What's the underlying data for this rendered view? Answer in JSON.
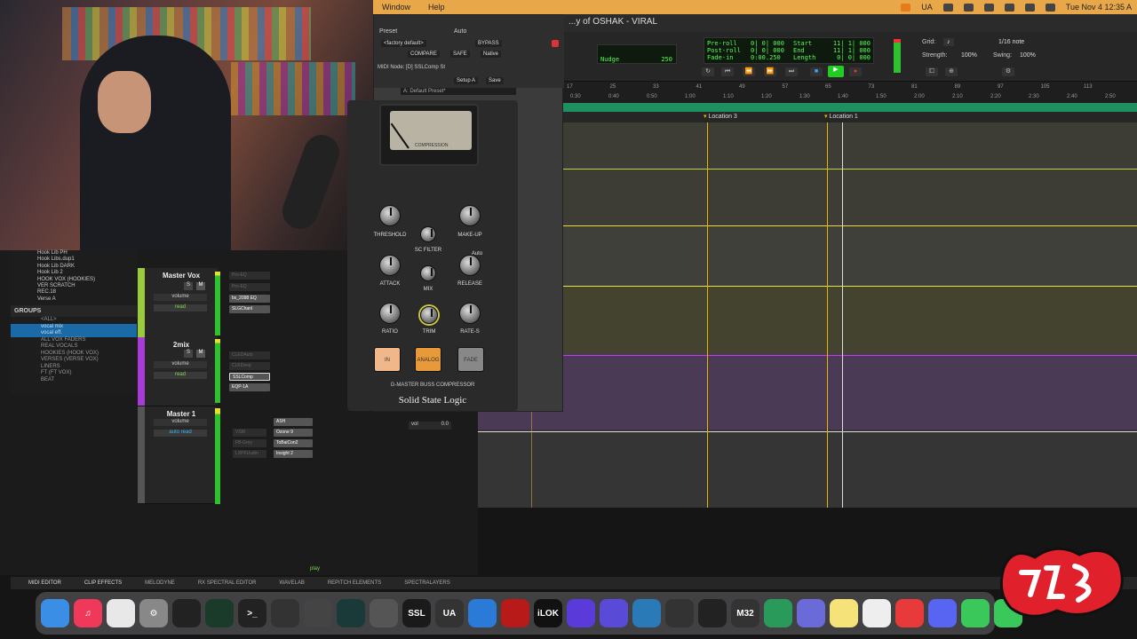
{
  "menubar": {
    "items": [
      "Window",
      "Help"
    ],
    "right": {
      "lang": "UA",
      "datetime": "Tue Nov 4  12:35 A"
    }
  },
  "session": {
    "title": "...y of OSHAK - VIRAL"
  },
  "transport": {
    "grid_label": "Grid:",
    "grid_value": "1/16 note",
    "strength_label": "Strength:",
    "strength_value": "100%",
    "swing_label": "Swing:",
    "swing_value": "100%",
    "nudge_label": "Nudge",
    "nudge_value": "250",
    "preroll": "Pre-roll",
    "postroll": "Post-roll",
    "fadein": "Fade-in",
    "start": "Start",
    "end": "End",
    "length": "Length",
    "preroll_val": "0| 0| 000",
    "postroll_val": "0| 0| 000",
    "fadein_val": "0:00.250",
    "start_val": "11| 1| 000",
    "end_val": "11| 1| 000",
    "length_val": "0| 0| 000"
  },
  "ruler": {
    "bars": [
      "17",
      "25",
      "33",
      "41",
      "49",
      "57",
      "65",
      "73",
      "81",
      "89",
      "97",
      "105",
      "113"
    ],
    "times": [
      "0:30",
      "0:40",
      "0:50",
      "1:00",
      "1:10",
      "1:20",
      "1:30",
      "1:40",
      "1:50",
      "2:00",
      "2:10",
      "2:20",
      "2:30",
      "2:40",
      "2:50"
    ]
  },
  "markers": [
    {
      "label": "Location 3"
    },
    {
      "label": "Location 1"
    }
  ],
  "plugin": {
    "preset_label": "Preset",
    "auto_label": "Auto",
    "preset_value": "<factory default>",
    "compare": "COMPARE",
    "bypass": "BYPASS",
    "safe": "SAFE",
    "native": "Native",
    "midi_node": "MIDI Node: [D] SSLComp St",
    "setup": "Setup A",
    "save": "Save",
    "preset_name": "A: Default Preset*",
    "meter_label": "COMPRESSION",
    "knobs": {
      "threshold": "THRESHOLD",
      "makeup": "MAKE-UP",
      "scfilter": "SC FILTER",
      "attack": "ATTACK",
      "release": "RELEASE",
      "mix": "MIX",
      "ratio": "RATIO",
      "trim": "TRIM",
      "rates": "RATE-S",
      "auto": "Auto"
    },
    "buttons": {
      "in": "IN",
      "analog": "ANALOG",
      "fade": "FADE OFF"
    },
    "product": "G-MASTER BUSS COMPRESSOR",
    "brand": "Solid State Logic"
  },
  "tracklist": [
    "Hook Lib PH",
    "Hook Libs.dup1",
    "Hook Lib DARK",
    "Hook Lib 2",
    "HOOK VOX (HOOKIES)",
    "VER SCRATCH",
    "REC.18",
    "Verse A"
  ],
  "groups": {
    "header": "GROUPS",
    "items": [
      "<ALL>",
      "vocal mix",
      "vocal eff.",
      "ALL VOX FADERS",
      "REAL VOCALS",
      "HOOKIES (HOOK VOX)",
      "VERSES (VERSE VOX)",
      "LINERS",
      "FT (FT VOX)",
      "BEAT"
    ]
  },
  "strips": [
    {
      "name": "Master Vox",
      "vol": "volume",
      "auto": "read",
      "inserts": [
        "Pro-EQ",
        "Pro-EQ",
        "bx_2098 EQ",
        "SLGChanl"
      ]
    },
    {
      "name": "2mix",
      "vol": "volume",
      "auto": "read",
      "inserts": [
        "CLEDAuto",
        "CLKDeep",
        "SSLComp",
        "EQP-1A"
      ]
    },
    {
      "name": "Master 1",
      "vol": "volume",
      "auto": "auto read",
      "inserts": [
        "ASH",
        "Ozone 9",
        "ToBaiCon2",
        "Insight 2"
      ],
      "dims": [
        "VSM",
        "FB-Grey",
        "LXPFUudm"
      ]
    }
  ],
  "mix_extra": {
    "vol_label": "vol",
    "vol_value": "0.0",
    "play_label": "play"
  },
  "bottom_tabs": [
    "MIDI EDITOR",
    "CLIP EFFECTS",
    "MELODYNE",
    "RX SPECTRAL EDITOR",
    "WAVELAB",
    "REPITCH ELEMENTS",
    "SPECTRALAYERS"
  ],
  "dock": [
    {
      "name": "finder-icon",
      "label": "",
      "color": "#3a8ee6"
    },
    {
      "name": "music-icon",
      "label": "♫",
      "color": "#f0385a"
    },
    {
      "name": "chrome-icon",
      "label": "",
      "color": "#e8e8e8"
    },
    {
      "name": "settings-icon",
      "label": "⚙",
      "color": "#888"
    },
    {
      "name": "piano-icon",
      "label": "",
      "color": "#222"
    },
    {
      "name": "activity-icon",
      "label": "",
      "color": "#1a3a2a"
    },
    {
      "name": "terminal-icon",
      "label": ">_",
      "color": "#222"
    },
    {
      "name": "pro-tools-icon",
      "label": "",
      "color": "#333"
    },
    {
      "name": "crop-icon",
      "label": "",
      "color": "#444"
    },
    {
      "name": "wave-icon",
      "label": "",
      "color": "#1a3a3a"
    },
    {
      "name": "clip-icon",
      "label": "",
      "color": "#555"
    },
    {
      "name": "ssl-icon",
      "label": "SSL",
      "color": "#1a1a1a"
    },
    {
      "name": "ua-icon",
      "label": "UA",
      "color": "#333"
    },
    {
      "name": "waves-icon",
      "label": "",
      "color": "#2a7ad8"
    },
    {
      "name": "red-icon",
      "label": "",
      "color": "#b81a1a"
    },
    {
      "name": "ilok-icon",
      "label": "iLOK",
      "color": "#111"
    },
    {
      "name": "native-access-icon",
      "label": "",
      "color": "#5a3ad8"
    },
    {
      "name": "avid-icon",
      "label": "",
      "color": "#5a4ad8"
    },
    {
      "name": "plugin-icon",
      "label": "",
      "color": "#2a7ab8"
    },
    {
      "name": "dj-icon",
      "label": "",
      "color": "#333"
    },
    {
      "name": "mixer-icon",
      "label": "",
      "color": "#222"
    },
    {
      "name": "m32-icon",
      "label": "M32",
      "color": "#333"
    },
    {
      "name": "slack-icon",
      "label": "",
      "color": "#2a9a5a"
    },
    {
      "name": "app-icon",
      "label": "",
      "color": "#6a6ad8"
    },
    {
      "name": "notes-icon",
      "label": "",
      "color": "#f5e37a"
    },
    {
      "name": "stocks-icon",
      "label": "",
      "color": "#eee"
    },
    {
      "name": "share-icon",
      "label": "",
      "color": "#e83a3a"
    },
    {
      "name": "discord-icon",
      "label": "",
      "color": "#5865f2"
    },
    {
      "name": "messages-icon",
      "label": "",
      "color": "#3ac85a"
    },
    {
      "name": "facetime-icon",
      "label": "",
      "color": "#3ac85a"
    }
  ],
  "colors": {
    "accent_green": "#1f8f5f",
    "marker_yellow": "#e8b400",
    "strip_green": "#9acb3a",
    "strip_purple": "#a83ad8"
  }
}
